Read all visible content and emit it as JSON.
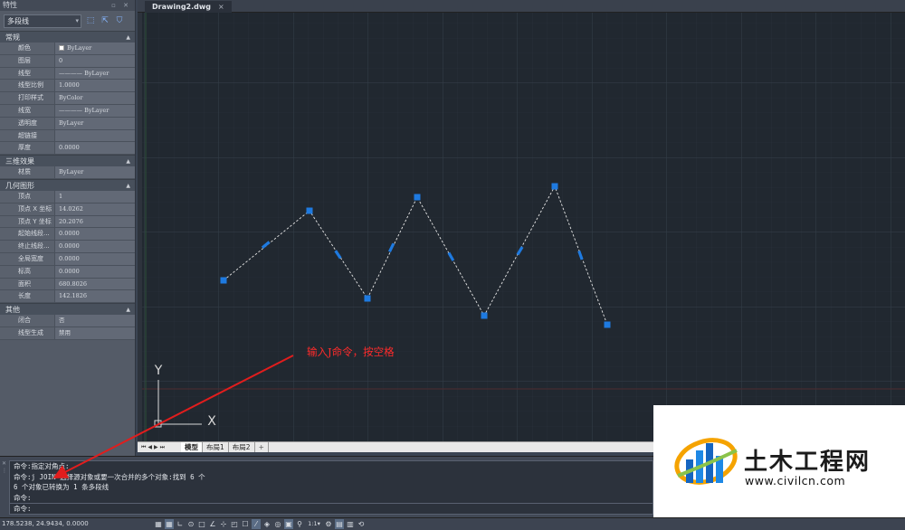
{
  "props": {
    "title": "特性",
    "title_buttons": "▫ ✕",
    "selector": "多段线",
    "sections": [
      {
        "name": "常规",
        "rows": [
          {
            "k": "颜色",
            "v": "ByLayer"
          },
          {
            "k": "图层",
            "v": "0"
          },
          {
            "k": "线型",
            "v": "———— ByLayer"
          },
          {
            "k": "线型比例",
            "v": "1.0000"
          },
          {
            "k": "打印样式",
            "v": "ByColor"
          },
          {
            "k": "线宽",
            "v": "———— ByLayer"
          },
          {
            "k": "透明度",
            "v": "ByLayer"
          },
          {
            "k": "超链接",
            "v": ""
          },
          {
            "k": "厚度",
            "v": "0.0000"
          }
        ]
      },
      {
        "name": "三维效果",
        "rows": [
          {
            "k": "材质",
            "v": "ByLayer"
          }
        ]
      },
      {
        "name": "几何图形",
        "rows": [
          {
            "k": "顶点",
            "v": "1"
          },
          {
            "k": "顶点 X 坐标",
            "v": "14.0262"
          },
          {
            "k": "顶点 Y 坐标",
            "v": "20.2076"
          },
          {
            "k": "起始线段...",
            "v": "0.0000"
          },
          {
            "k": "终止线段...",
            "v": "0.0000"
          },
          {
            "k": "全局宽度",
            "v": "0.0000"
          },
          {
            "k": "标高",
            "v": "0.0000"
          },
          {
            "k": "面积",
            "v": "680.8026"
          },
          {
            "k": "长度",
            "v": "142.1826"
          }
        ]
      },
      {
        "name": "其他",
        "rows": [
          {
            "k": "闭合",
            "v": "否"
          },
          {
            "k": "线型生成",
            "v": "禁用"
          }
        ]
      }
    ]
  },
  "document": {
    "tab_title": "Drawing2.dwg",
    "close": "×"
  },
  "layout": {
    "nav": "⏮◀▶⏭",
    "tabs": [
      "模型",
      "布局1",
      "布局2"
    ],
    "add": "+"
  },
  "ucs": {
    "x_label": "X",
    "y_label": "Y"
  },
  "command": {
    "lines": [
      "命令:指定对角点:",
      "命令:j JOIN 选择源对象或要一次合并的多个对象:找到 6 个",
      "6 个对象已转换为 1 条多段线",
      "命令:"
    ],
    "prompt": "命令:"
  },
  "status": {
    "coords": "178.5238, 24.9434, 0.0000",
    "icons": [
      "▦",
      "▦",
      "∟",
      "⊙",
      "□",
      "∠",
      "⊹",
      "◰",
      "☐",
      "⁄",
      "◈",
      "◎",
      "▣",
      "⚲",
      "1:1▾",
      "⚙",
      "▤",
      "▥",
      "⟲"
    ]
  },
  "annotation": {
    "text": "输入J命令，按空格",
    "color": "#ff2b2b"
  },
  "watermark": {
    "brand": "土木工程网",
    "url": "www.civilcn.com"
  },
  "colors": {
    "canvas_bg": "#212830",
    "grip": "#1e7ae0",
    "polyline": "#e6e6e6"
  }
}
